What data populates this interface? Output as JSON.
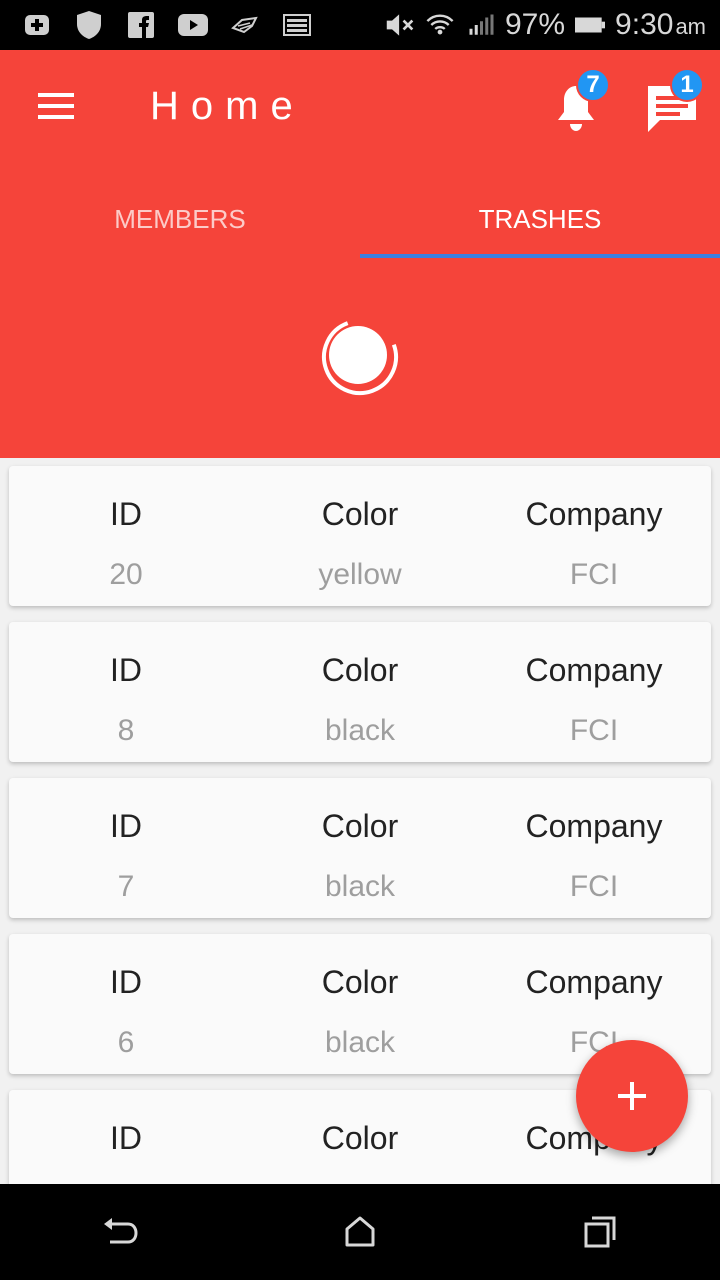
{
  "status_bar": {
    "battery": "97%",
    "time": "9:30",
    "ampm": "am"
  },
  "app_bar": {
    "title": "Home",
    "notifications_count": "7",
    "messages_count": "1"
  },
  "tabs": [
    {
      "label": "MEMBERS",
      "active": false
    },
    {
      "label": "TRASHES",
      "active": true
    }
  ],
  "columns": {
    "id": "ID",
    "color": "Color",
    "company": "Company"
  },
  "rows": [
    {
      "id": "20",
      "color": "yellow",
      "company": "FCI"
    },
    {
      "id": "8",
      "color": "black",
      "company": "FCI"
    },
    {
      "id": "7",
      "color": "black",
      "company": "FCI"
    },
    {
      "id": "6",
      "color": "black",
      "company": "FCI"
    },
    {
      "id": "",
      "color": "",
      "company": ""
    }
  ],
  "theme": {
    "primary": "#f5443a",
    "tab_indicator": "#3b7fe0",
    "badge": "#2196f3"
  }
}
